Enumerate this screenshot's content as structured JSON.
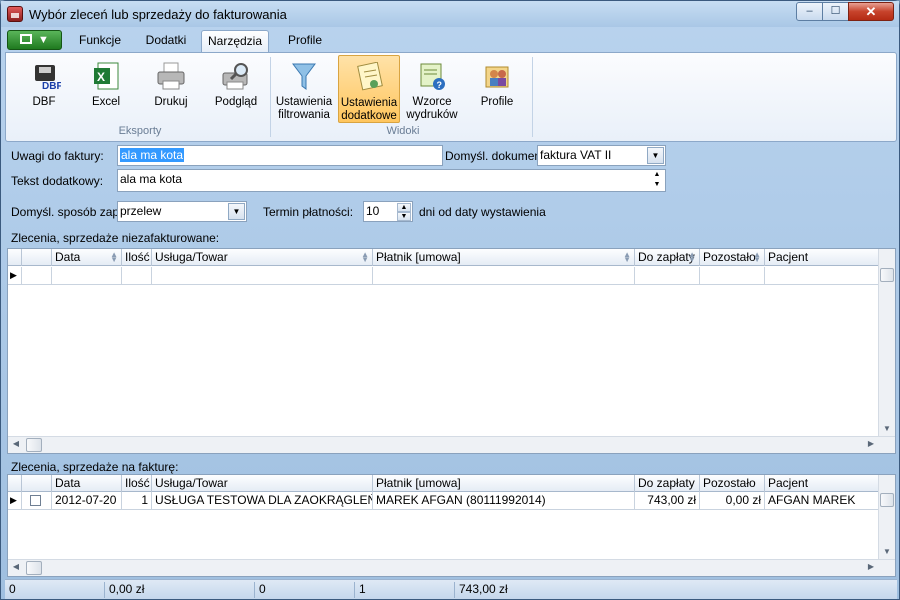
{
  "window": {
    "title": "Wybór zleceń lub sprzedaży do fakturowania",
    "controls": {
      "minimize": "–",
      "maximize": "☐",
      "close": "✕"
    }
  },
  "ribbon": {
    "tabs": [
      {
        "label": "Funkcje"
      },
      {
        "label": "Dodatki"
      },
      {
        "label": "Narzędzia",
        "active": true
      },
      {
        "label": "Profile"
      }
    ],
    "buttons": [
      {
        "label": "DBF",
        "icon": "dbf-icon"
      },
      {
        "label": "Excel",
        "icon": "excel-icon"
      },
      {
        "label": "Drukuj",
        "icon": "printer-icon"
      },
      {
        "label": "Podgląd",
        "icon": "print-preview-icon"
      },
      {
        "label": "Ustawienia filtrowania",
        "line1": "Ustawienia",
        "line2": "filtrowania",
        "icon": "filter-icon"
      },
      {
        "label": "Ustawienia dodatkowe",
        "line1": "Ustawienia",
        "line2": "dodatkowe",
        "icon": "settings-note-icon",
        "selected": true
      },
      {
        "label": "Wzorce wydruków",
        "line1": "Wzorce",
        "line2": "wydruków",
        "icon": "template-icon"
      },
      {
        "label": "Profile",
        "icon": "profiles-icon"
      }
    ],
    "groups": {
      "exports": "Eksporty",
      "views": "Widoki"
    }
  },
  "form": {
    "notes_label": "Uwagi do faktury:",
    "notes_value": "ala ma kota",
    "doc_label": "Domyśl. dokument:",
    "doc_value": "faktura VAT II",
    "extra_label": "Tekst dodatkowy:",
    "extra_value": "ala ma kota",
    "payment_label": "Domyśl. sposób zapł.:",
    "payment_value": "przelew",
    "term_label": "Termin płatności:",
    "term_value": "10",
    "term_suffix": "dni od daty wystawienia"
  },
  "grid_top": {
    "caption": "Zlecenia, sprzedaże niezafakturowane:",
    "columns": [
      "Data",
      "Ilość",
      "Usługa/Towar",
      "Płatnik [umowa]",
      "Do zapłaty",
      "Pozostało",
      "Pacjent"
    ],
    "rows": []
  },
  "grid_bottom": {
    "caption": "Zlecenia, sprzedaże na fakturę:",
    "columns": [
      "Data",
      "Ilość",
      "Usługa/Towar",
      "Płatnik [umowa]",
      "Do zapłaty",
      "Pozostało",
      "Pacjent"
    ],
    "rows": [
      {
        "checked": false,
        "date": "2012-07-20",
        "qty": "1",
        "item": "USŁUGA TESTOWA DLA ZAOKRĄGLEŃ",
        "payer": "MAREK AFGAN (80111992014)",
        "to_pay": "743,00 zł",
        "remaining": "0,00 zł",
        "patient": "AFGAN MAREK"
      }
    ]
  },
  "statusbar": {
    "cells": [
      "0",
      "0,00 zł",
      "0",
      "1",
      "743,00 zł"
    ]
  },
  "colors": {
    "ribbon_selected": "#ffc65e",
    "selection": "#3399ff",
    "window_frame": "#9fbfe0"
  }
}
